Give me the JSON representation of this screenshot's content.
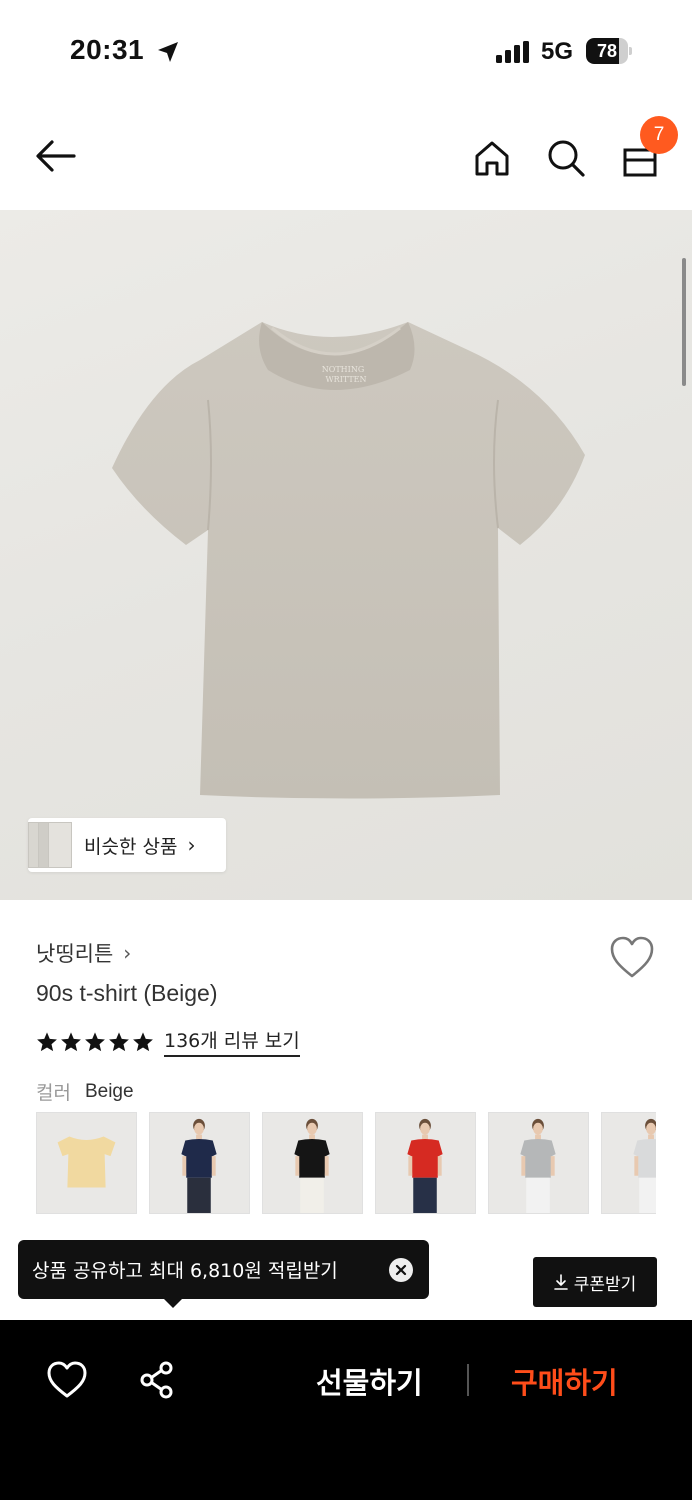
{
  "status_bar": {
    "time": "20:31",
    "network": "5G",
    "battery": "78",
    "battery_level": 0.78
  },
  "nav": {
    "cart_count": "7"
  },
  "similar_products": {
    "label": "비슷한 상품",
    "chevron": "›"
  },
  "product": {
    "brand": "낫띵리튼",
    "brand_chevron": "›",
    "name": "90s t-shirt (Beige)",
    "rating": 5,
    "review_link": "136개 리뷰 보기",
    "color_label": "컬러",
    "color_value": "Beige"
  },
  "color_options": [
    {
      "name": "beige-tee",
      "tone": "#f1d9a0"
    },
    {
      "name": "navy-tee",
      "tone": "#1f2a4a"
    },
    {
      "name": "black-tee",
      "tone": "#151515"
    },
    {
      "name": "red-tee",
      "tone": "#d62a22"
    },
    {
      "name": "gray-tee",
      "tone": "#b5b7b8"
    },
    {
      "name": "light-gray-tee",
      "tone": "#d9dadb"
    }
  ],
  "tooltip": {
    "text": "상품 공유하고 최대 6,810원 적립받기"
  },
  "coupon": {
    "label": "쿠폰받기"
  },
  "bottom_bar": {
    "gift_label": "선물하기",
    "buy_label": "구매하기"
  },
  "colors": {
    "accent": "#ff4d1a",
    "badge": "#ff5a1f",
    "product_beige": "#c9c4bb"
  },
  "icons": [
    "location-arrow-icon",
    "signal-icon",
    "battery-icon",
    "back-arrow-icon",
    "home-icon",
    "search-icon",
    "shopping-bag-icon",
    "heart-icon",
    "star-icon",
    "close-icon",
    "download-icon",
    "share-icon"
  ]
}
